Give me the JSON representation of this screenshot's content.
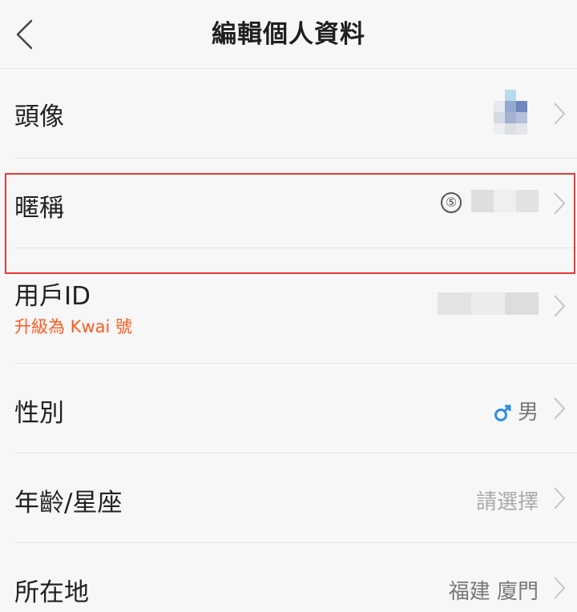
{
  "header": {
    "title": "編輯個人資料",
    "back_icon": "chevron-left-icon"
  },
  "rows": {
    "avatar": {
      "label": "頭像"
    },
    "nickname": {
      "label": "暱稱",
      "badge": "⑤"
    },
    "userid": {
      "label": "用戶ID",
      "sub": "升級為 Kwai 號"
    },
    "gender": {
      "label": "性別",
      "icon": "male-icon",
      "value": "男"
    },
    "age": {
      "label": "年齡/星座",
      "value": "請選擇"
    },
    "location": {
      "label": "所在地",
      "value": "福建 廈門"
    }
  },
  "colors": {
    "accent_orange": "#ff5a1f",
    "highlight_red": "#e53935",
    "male_blue": "#2a8fe6"
  }
}
